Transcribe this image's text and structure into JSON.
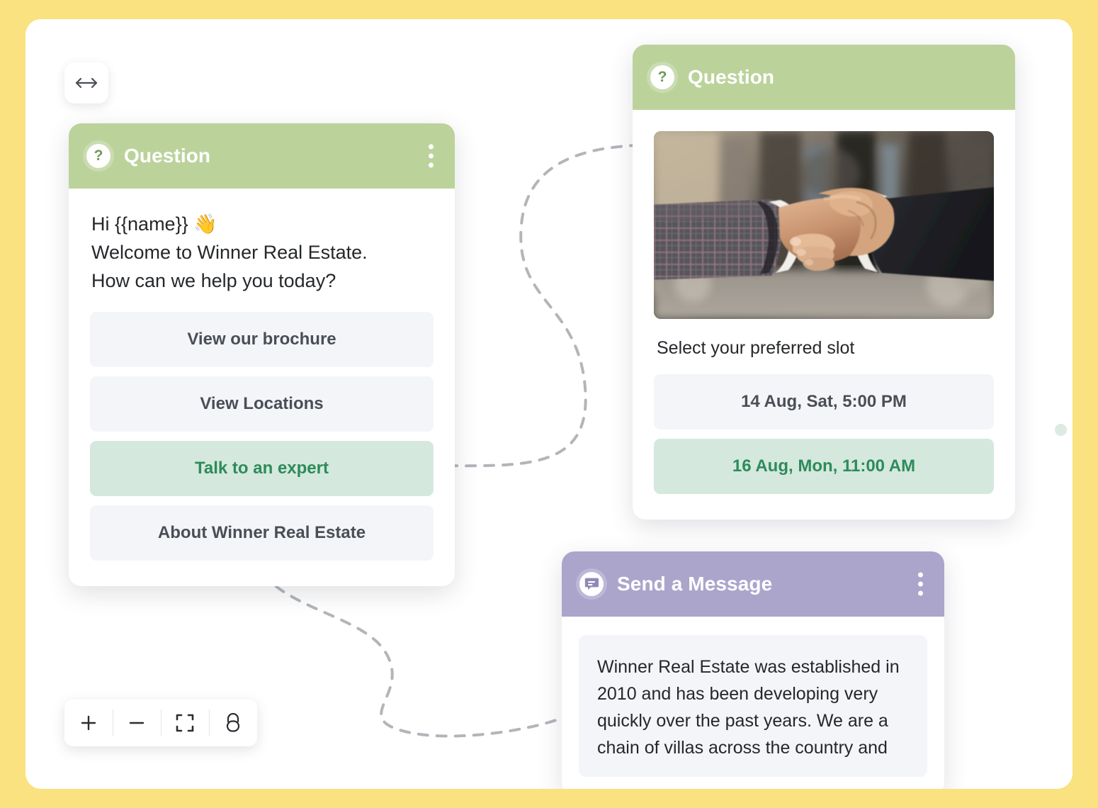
{
  "frame": {
    "accent_color": "#F9E27F",
    "canvas_color": "#FFFFFF"
  },
  "toolbar_top": {
    "pan_tool": "pan-resize-arrows"
  },
  "zoom_toolbar": {
    "buttons": [
      {
        "name": "zoom-in",
        "label": "+"
      },
      {
        "name": "zoom-out",
        "label": "−"
      },
      {
        "name": "fit-to-screen",
        "label": "fit"
      },
      {
        "name": "lock-canvas",
        "label": "lock"
      }
    ]
  },
  "cards": {
    "question_left": {
      "title": "Question",
      "icon": "question-mark-icon",
      "header_color": "#BBD39B",
      "menu": "kebab-menu",
      "message_lines": [
        "Hi {{name}} 👋",
        "Welcome to Winner Real Estate.",
        "How can we help you today?"
      ],
      "choices": [
        {
          "label": "View our brochure",
          "selected": false
        },
        {
          "label": "View Locations",
          "selected": false
        },
        {
          "label": "Talk to an expert",
          "selected": true
        },
        {
          "label": "About Winner Real Estate",
          "selected": false
        }
      ]
    },
    "question_right": {
      "title": "Question",
      "icon": "question-mark-icon",
      "header_color": "#BBD39B",
      "image_alt": "handshake-photo",
      "prompt": "Select your preferred slot",
      "slots": [
        {
          "label": "14 Aug, Sat, 5:00 PM",
          "selected": false
        },
        {
          "label": "16 Aug, Mon, 11:00 AM",
          "selected": true
        }
      ]
    },
    "send_message": {
      "title": "Send a Message",
      "icon": "chat-bubble-icon",
      "header_color": "#ABA5CC",
      "menu": "kebab-menu",
      "body": "Winner Real Estate was established in 2010 and has been developing very quickly over the past years. We are a chain of villas across the country and"
    }
  },
  "colors": {
    "selected_bg": "#D5E8DD",
    "selected_text": "#2D8B5B",
    "choice_bg": "#F3F5F8",
    "dot": "#DCEBE2"
  }
}
